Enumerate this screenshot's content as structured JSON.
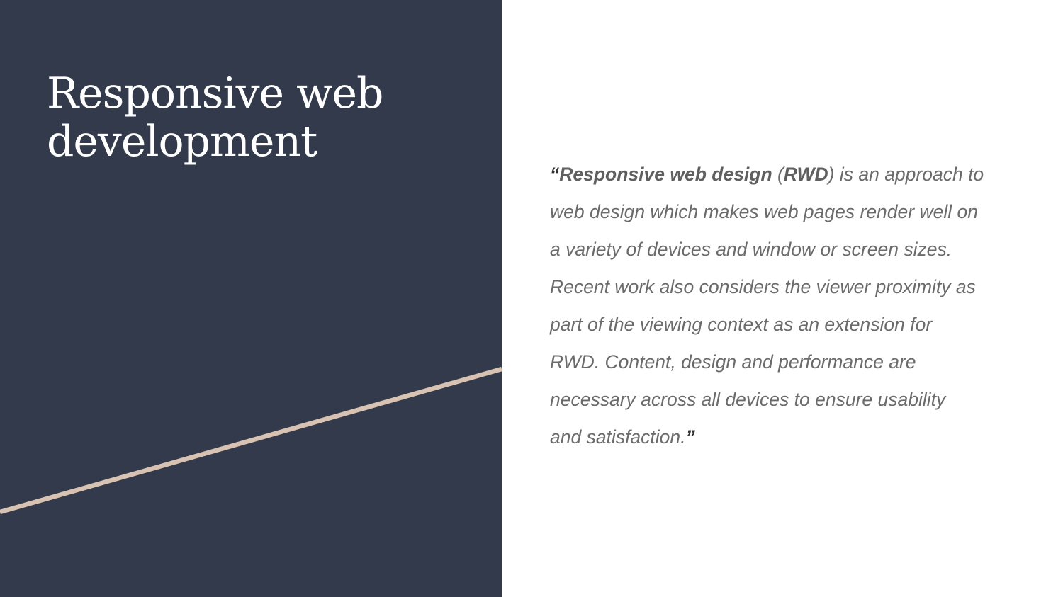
{
  "slide": {
    "title_lines": [
      "Responsive web",
      "development"
    ],
    "colors": {
      "panel": "#323a4c",
      "accent_line": "#d8c3b2",
      "quote_text": "#6b6b6b"
    },
    "quote": {
      "open_mark": "“",
      "term": "Responsive web design",
      "paren_open": " (",
      "abbr": "RWD",
      "first_line_rest": ") is an approach to",
      "lines": [
        "web design which makes web pages render well on",
        "a variety of devices and window or screen sizes.",
        "Recent work also considers the viewer proximity as",
        "part of the viewing context as an extension for",
        "RWD. Content, design and performance are",
        "necessary across all devices to ensure usability"
      ],
      "last_line": "and satisfaction.",
      "close_mark": "”"
    }
  }
}
